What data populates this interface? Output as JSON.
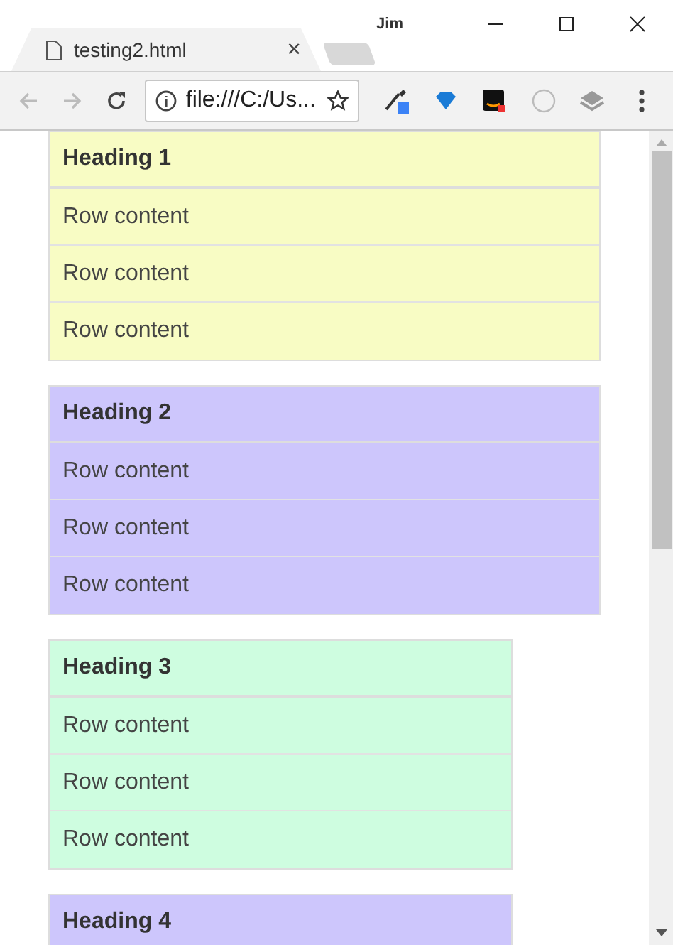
{
  "window": {
    "profile": "Jim"
  },
  "tabs": [
    {
      "title": "testing2.html",
      "close": "×",
      "selected": true
    }
  ],
  "toolbar": {
    "back_disabled": true,
    "forward_disabled": true,
    "address": "file:///C:/Us..."
  },
  "panels": [
    {
      "heading": "Heading 1",
      "color": "#f8fcc4",
      "kind": "wide",
      "rows": [
        "Row content",
        "Row content",
        "Row content"
      ]
    },
    {
      "heading": "Heading 2",
      "color": "#cdc6fc",
      "kind": "wide",
      "rows": [
        "Row content",
        "Row content",
        "Row content"
      ]
    },
    {
      "heading": "Heading 3",
      "color": "#cefde0",
      "kind": "narrow",
      "rows": [
        "Row content",
        "Row content",
        "Row content"
      ]
    },
    {
      "heading": "Heading 4",
      "color": "#cdc6fc",
      "kind": "narrow"
    }
  ]
}
